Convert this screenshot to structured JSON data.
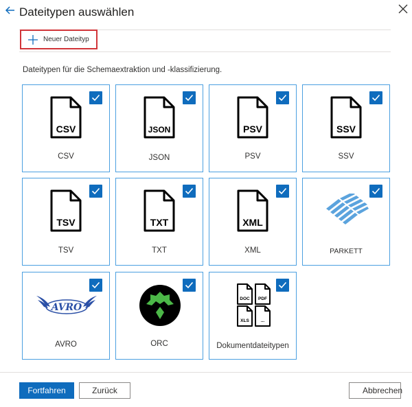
{
  "header": {
    "title": "Dateitypen auswählen"
  },
  "toolbar": {
    "new_label": "Neuer Dateityp"
  },
  "description": "Dateitypen für die Schemaextraktion und -klassifizierung.",
  "tiles": [
    {
      "label": "CSV",
      "badge": "CSV"
    },
    {
      "label": "JSON",
      "badge": "JSON"
    },
    {
      "label": "PSV",
      "badge": "PSV"
    },
    {
      "label": "SSV",
      "badge": "SSV"
    },
    {
      "label": "TSV",
      "badge": "TSV"
    },
    {
      "label": "TXT",
      "badge": "TXT"
    },
    {
      "label": "XML",
      "badge": "XML"
    },
    {
      "label": "PARKETT"
    },
    {
      "label": "AVRO",
      "logo_text": "AVRO"
    },
    {
      "label": "ORC"
    },
    {
      "label": "Dokumentdateitypen",
      "mini_badges": [
        "DOC",
        "PDF",
        "XLS",
        "..."
      ]
    }
  ],
  "footer": {
    "continue_label": "Fortfahren",
    "back_label": "Zurück",
    "cancel_label": "Abbrechen"
  },
  "colors": {
    "accent": "#0f6cbd",
    "highlight_border": "#d13438",
    "tile_border": "#4a9fe0"
  }
}
